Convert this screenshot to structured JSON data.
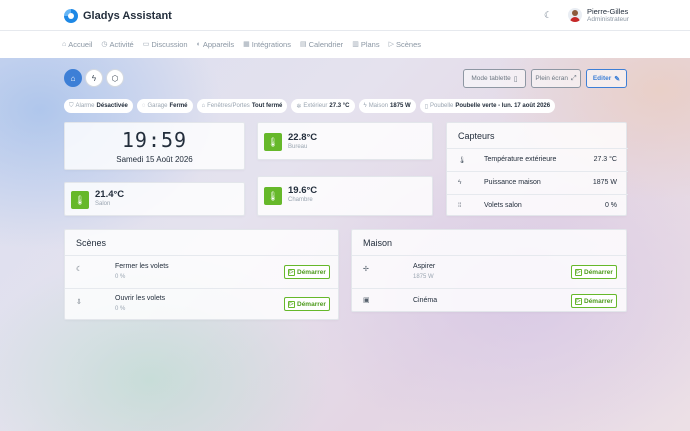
{
  "header": {
    "app_name": "Gladys Assistant",
    "user": {
      "name": "Pierre-Gilles",
      "role": "Administrateur"
    }
  },
  "nav": [
    {
      "label": "Accueil",
      "icon": "home-icon",
      "glyph": "⌂"
    },
    {
      "label": "Activité",
      "icon": "activity-icon",
      "glyph": "◷"
    },
    {
      "label": "Discussion",
      "icon": "chat-icon",
      "glyph": "▭"
    },
    {
      "label": "Appareils",
      "icon": "devices-icon",
      "glyph": "◐"
    },
    {
      "label": "Intégrations",
      "icon": "grid-icon",
      "glyph": "▦"
    },
    {
      "label": "Calendrier",
      "icon": "calendar-icon",
      "glyph": "▤"
    },
    {
      "label": "Plans",
      "icon": "map-icon",
      "glyph": "▥"
    },
    {
      "label": "Scènes",
      "icon": "play-icon",
      "glyph": "▷"
    }
  ],
  "toolbar": {
    "dashboards": [
      {
        "icon": "home-icon",
        "glyph": "⌂"
      },
      {
        "icon": "lightning-icon",
        "glyph": "ϟ"
      },
      {
        "icon": "shield-icon",
        "glyph": "⬡"
      }
    ],
    "tablet_mode": "Mode tablette",
    "fullscreen": "Plein écran",
    "edit": "Editer"
  },
  "status_pills": [
    {
      "label": "Alarme",
      "value": "Désactivée",
      "glyph": "⛉"
    },
    {
      "label": "Garage",
      "value": "Fermé",
      "glyph": "◌"
    },
    {
      "label": "Fenêtres/Portes",
      "value": "Tout fermé",
      "glyph": "⌂"
    },
    {
      "label": "Extérieur",
      "value": "27.3 °C",
      "glyph": "✲"
    },
    {
      "label": "Maison",
      "value": "1875 W",
      "glyph": "ϟ"
    },
    {
      "label": "Poubelle",
      "value": "Poubelle verte - lun. 17 août 2026",
      "glyph": "▯"
    }
  ],
  "clock": {
    "time": "19:59",
    "date": "Samedi 15 Août 2026"
  },
  "temperatures": [
    {
      "value": "22.8°C",
      "room": "Bureau"
    },
    {
      "value": "21.4°C",
      "room": "Salon"
    },
    {
      "value": "19.6°C",
      "room": "Chambre"
    }
  ],
  "sensors": {
    "title": "Capteurs",
    "rows": [
      {
        "name": "Température extérieure",
        "value": "27.3 °C",
        "glyph": "🌡"
      },
      {
        "name": "Puissance maison",
        "value": "1875 W",
        "glyph": "ϟ"
      },
      {
        "name": "Volets salon",
        "value": "0 %",
        "glyph": "⁞⁞"
      }
    ]
  },
  "scenes": {
    "title": "Scènes",
    "rows": [
      {
        "name": "Fermer les volets",
        "sub": "0 %",
        "glyph": "☾",
        "action": "Démarrer"
      },
      {
        "name": "Ouvrir les volets",
        "sub": "0 %",
        "glyph": "⇩",
        "action": "Démarrer"
      }
    ]
  },
  "maison": {
    "title": "Maison",
    "rows": [
      {
        "name": "Aspirer",
        "sub": "1875 W",
        "glyph": "✢",
        "action": "Démarrer"
      },
      {
        "name": "Cinéma",
        "sub": "",
        "glyph": "▣",
        "action": "Démarrer"
      }
    ]
  },
  "colors": {
    "accent": "#3d7fd6",
    "success": "#66b82a"
  }
}
